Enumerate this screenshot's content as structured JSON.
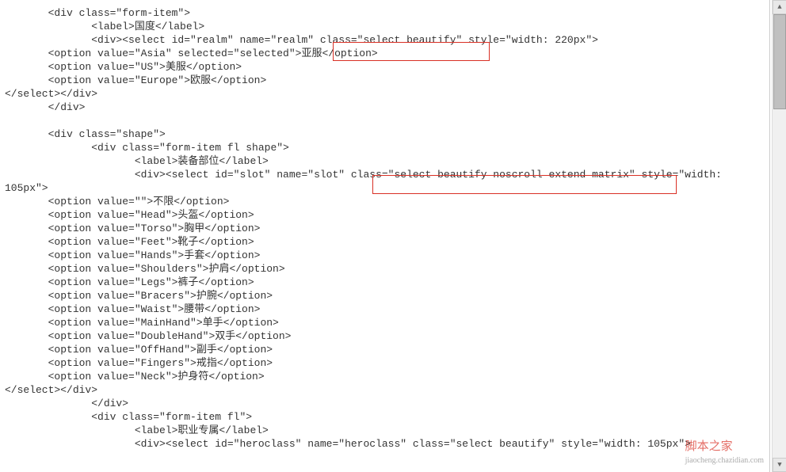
{
  "lines": [
    "       <div class=\"form-item\">",
    "              <label>国度</label>",
    "              <div><select id=\"realm\" name=\"realm\" class=\"select beautify\" style=\"width: 220px\">",
    "       <option value=\"Asia\" selected=\"selected\">亚服</option>",
    "       <option value=\"US\">美服</option>",
    "       <option value=\"Europe\">欧服</option>",
    "</select></div>",
    "       </div>",
    "",
    "       <div class=\"shape\">",
    "              <div class=\"form-item fl shape\">",
    "                     <label>装备部位</label>",
    "                     <div><select id=\"slot\" name=\"slot\" class=\"select beautify noscroll extend matrix\" style=\"width: ",
    "105px\">",
    "       <option value=\"\">不限</option>",
    "       <option value=\"Head\">头盔</option>",
    "       <option value=\"Torso\">胸甲</option>",
    "       <option value=\"Feet\">靴子</option>",
    "       <option value=\"Hands\">手套</option>",
    "       <option value=\"Shoulders\">护肩</option>",
    "       <option value=\"Legs\">裤子</option>",
    "       <option value=\"Bracers\">护腕</option>",
    "       <option value=\"Waist\">腰带</option>",
    "       <option value=\"MainHand\">单手</option>",
    "       <option value=\"DoubleHand\">双手</option>",
    "       <option value=\"OffHand\">副手</option>",
    "       <option value=\"Fingers\">戒指</option>",
    "       <option value=\"Neck\">护身符</option>",
    "</select></div>",
    "              </div>",
    "              <div class=\"form-item fl\">",
    "                     <label>职业专属</label>",
    "                     <div><select id=\"heroclass\" name=\"heroclass\" class=\"select beautify\" style=\"width: 105px\">"
  ],
  "watermark": {
    "main": "脚本之家",
    "sub": "jiaocheng.chazidian.com"
  }
}
